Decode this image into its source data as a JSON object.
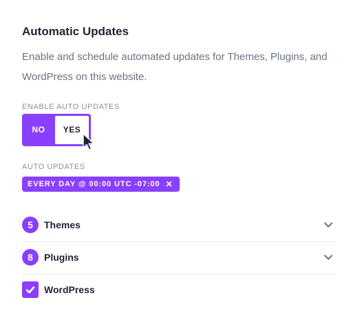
{
  "section": {
    "title": "Automatic Updates",
    "description": "Enable and schedule automated updates for Themes, Plugins, and WordPress on this website."
  },
  "enable": {
    "label": "ENABLE AUTO UPDATES",
    "no_label": "NO",
    "yes_label": "YES",
    "selected": "YES"
  },
  "schedule": {
    "label": "AUTO UPDATES",
    "chip_text": "EVERY DAY @ 00:00 UTC -07:00",
    "chip_close": "✕"
  },
  "items": [
    {
      "count": "5",
      "label": "Themes"
    },
    {
      "count": "8",
      "label": "Plugins"
    },
    {
      "label": "WordPress",
      "checked": true
    }
  ],
  "colors": {
    "accent": "#8a3ffc",
    "text": "#1f2433",
    "muted": "#6b7280",
    "divider": "#e5e7eb"
  }
}
